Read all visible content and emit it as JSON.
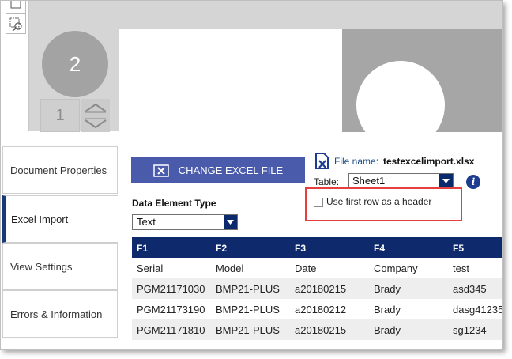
{
  "design_area": {
    "page_number": "2",
    "page_index": "1"
  },
  "tabs": [
    {
      "label": "Document Properties"
    },
    {
      "label": "Excel Import"
    },
    {
      "label": "View Settings"
    },
    {
      "label": "Errors & Information"
    }
  ],
  "import": {
    "change_button_label": "CHANGE EXCEL FILE",
    "file_name_label": "File name:",
    "file_name_value": "testexcelimport.xlsx",
    "table_label": "Table:",
    "table_value": "Sheet1",
    "first_row_header_label": "Use first row as a header",
    "first_row_header_checked": false,
    "data_element_type_label": "Data Element Type",
    "data_element_type_value": "Text"
  },
  "grid": {
    "columns": [
      "F1",
      "F2",
      "F3",
      "F4",
      "F5"
    ],
    "rows": [
      [
        "Serial",
        "Model",
        "Date",
        "Company",
        "test"
      ],
      [
        "PGM21171030",
        "BMP21-PLUS",
        "a20180215",
        "Brady",
        "asd345"
      ],
      [
        "PGM21173190",
        "BMP21-PLUS",
        "a20180212",
        "Brady",
        "dasg41235"
      ],
      [
        "PGM21171810",
        "BMP21-PLUS",
        "a20180215",
        "Brady",
        "sg1234"
      ]
    ]
  },
  "colors": {
    "accent": "#0f2a6c",
    "button": "#4a5bab",
    "highlight": "#e53f3f"
  }
}
